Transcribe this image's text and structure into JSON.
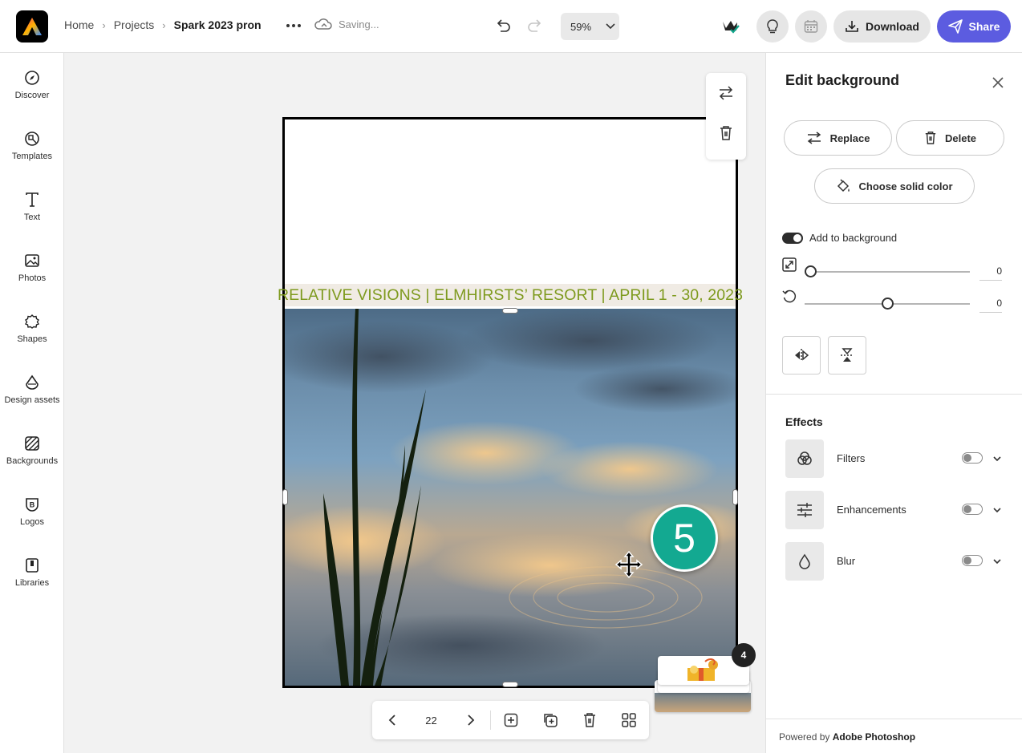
{
  "header": {
    "breadcrumbs": [
      "Home",
      "Projects"
    ],
    "project_name": "Spark 2023 pron",
    "save_status": "Saving...",
    "zoom": "59%",
    "download_label": "Download",
    "share_label": "Share",
    "share_color": "#5c5ce0"
  },
  "sidebar": {
    "items": [
      {
        "label": "Discover",
        "icon": "compass-icon"
      },
      {
        "label": "Templates",
        "icon": "templates-icon"
      },
      {
        "label": "Text",
        "icon": "text-icon"
      },
      {
        "label": "Photos",
        "icon": "photo-icon"
      },
      {
        "label": "Shapes",
        "icon": "shape-icon"
      },
      {
        "label": "Design assets",
        "icon": "design-assets-icon"
      },
      {
        "label": "Backgrounds",
        "icon": "backgrounds-icon"
      },
      {
        "label": "Logos",
        "icon": "logo-icon"
      },
      {
        "label": "Libraries",
        "icon": "library-icon"
      }
    ]
  },
  "canvas": {
    "banner_text": "RELATIVE VISIONS | ELMHIRSTS’ RESORT | APRIL 1 - 30, 2023",
    "banner_color": "#7e9a1e",
    "step_badge": "5",
    "page_number": "22",
    "thumbnail_count": "4"
  },
  "panel": {
    "title": "Edit background",
    "replace_label": "Replace",
    "delete_label": "Delete",
    "solid_color_label": "Choose solid color",
    "add_to_background_label": "Add to background",
    "add_to_background_on": true,
    "scale_value": "0",
    "rotate_value": "0",
    "effects_title": "Effects",
    "effects": [
      {
        "label": "Filters",
        "icon": "filters-icon",
        "enabled": false
      },
      {
        "label": "Enhancements",
        "icon": "sliders-icon",
        "enabled": false
      },
      {
        "label": "Blur",
        "icon": "droplet-icon",
        "enabled": false
      }
    ],
    "powered_prefix": "Powered by",
    "powered_brand": "Adobe Photoshop"
  }
}
